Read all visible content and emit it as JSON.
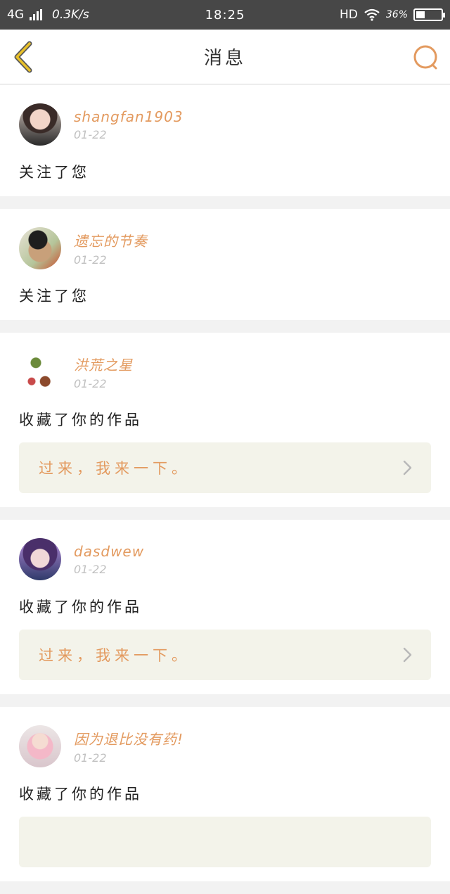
{
  "status_bar": {
    "network": "4G",
    "speed": "0.3K/s",
    "time": "18:25",
    "hd": "HD",
    "battery": "36%",
    "battery_level": 0.36
  },
  "header": {
    "title": "消息"
  },
  "messages": [
    {
      "username": "shangfan1903",
      "date": "01-22",
      "action": "关注了您"
    },
    {
      "username": "遗忘的节奏",
      "date": "01-22",
      "action": "关注了您"
    },
    {
      "username": "洪荒之星",
      "date": "01-22",
      "action": "收藏了你的作品",
      "work_title": "过来，我来一下。"
    },
    {
      "username": "dasdwew",
      "date": "01-22",
      "action": "收藏了你的作品",
      "work_title": "过来，我来一下。"
    },
    {
      "username": "因为退比没有药!",
      "date": "01-22",
      "action": "收藏了你的作品"
    }
  ],
  "colors": {
    "accent": "#e39a5f",
    "back_arrow": "#e8c02a",
    "status_bar_bg": "#474747"
  },
  "icons": {
    "back": "back-arrow-icon",
    "search": "search-icon",
    "chevron": "chevron-right-icon"
  }
}
